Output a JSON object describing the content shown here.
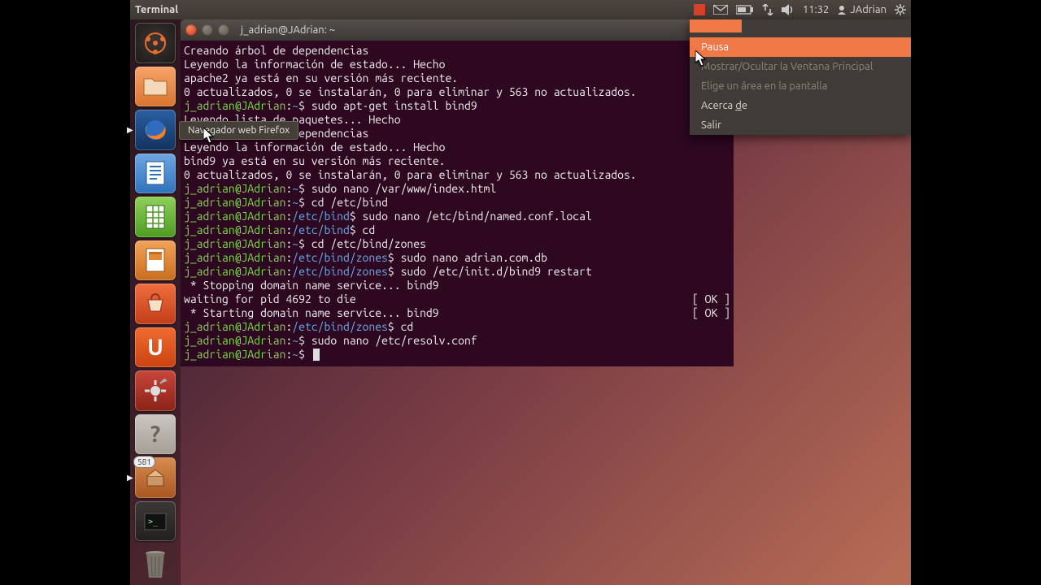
{
  "topbar": {
    "title": "Terminal",
    "time": "11:32",
    "user": "JAdrian"
  },
  "launcher": {
    "firefox_tooltip": "Navegador web Firefox",
    "update_badge": "581"
  },
  "terminal": {
    "title": "j_adrian@JAdrian: ~",
    "lines": [
      "Creando árbol de dependencias",
      "Leyendo la información de estado... Hecho",
      "apache2 ya está en su versión más reciente.",
      "0 actualizados, 0 se instalarán, 0 para eliminar y 563 no actualizados."
    ],
    "p1": {
      "user": "j_adrian@JAdrian",
      "path": "~",
      "cmd": "sudo apt-get install bind9"
    },
    "l6": "Leyendo lista de paquetes... Hecho",
    "l7": "Creando árbol de dependencias",
    "l8": "Leyendo la información de estado... Hecho",
    "l9": "bind9 ya está en su versión más reciente.",
    "l10": "0 actualizados, 0 se instalarán, 0 para eliminar y 563 no actualizados.",
    "p2": {
      "user": "j_adrian@JAdrian",
      "path": "~",
      "cmd": "sudo nano /var/www/index.html"
    },
    "p3": {
      "user": "j_adrian@JAdrian",
      "path": "~",
      "cmd": "cd /etc/bind"
    },
    "p4": {
      "user": "j_adrian@JAdrian",
      "path": "/etc/bind",
      "cmd": "sudo nano /etc/bind/named.conf.local"
    },
    "p5": {
      "user": "j_adrian@JAdrian",
      "path": "/etc/bind",
      "cmd": "cd"
    },
    "p6": {
      "user": "j_adrian@JAdrian",
      "path": "~",
      "cmd": "cd /etc/bind/zones"
    },
    "p7": {
      "user": "j_adrian@JAdrian",
      "path": "/etc/bind/zones",
      "cmd": "sudo nano adrian.com.db"
    },
    "p8": {
      "user": "j_adrian@JAdrian",
      "path": "/etc/bind/zones",
      "cmd": "sudo /etc/init.d/bind9 restart"
    },
    "l_stop": " * Stopping domain name service... bind9",
    "l_wait": "waiting for pid 4692 to die",
    "ok1": "[ OK ]",
    "l_start": " * Starting domain name service... bind9",
    "ok2": "[ OK ]",
    "p9": {
      "user": "j_adrian@JAdrian",
      "path": "/etc/bind/zones",
      "cmd": "cd"
    },
    "p10": {
      "user": "j_adrian@JAdrian",
      "path": "~",
      "cmd": "sudo nano /etc/resolv.conf"
    },
    "p11": {
      "user": "j_adrian@JAdrian",
      "path": "~",
      "cmd": ""
    }
  },
  "popup": {
    "items": [
      {
        "label": "Pausa",
        "hl": true
      },
      {
        "label": "Mostrar/Ocultar la Ventana Principal",
        "dim": true
      },
      {
        "label": "Elige un área en la pantalla",
        "dim": true
      },
      {
        "label_pre": "Acerca ",
        "label_u": "d",
        "label_post": "e"
      },
      {
        "label": "Salir"
      }
    ]
  }
}
